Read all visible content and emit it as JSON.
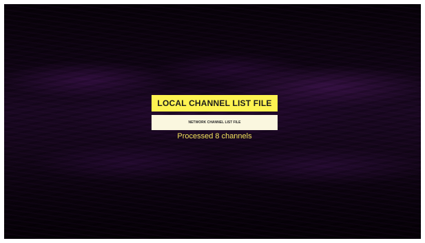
{
  "menu": {
    "local_label": "LOCAL CHANNEL LIST FILE",
    "network_label": "NETWORK CHANNEL LIST FILE"
  },
  "status": {
    "text": "Processed 8 channels"
  },
  "colors": {
    "primary_button": "#fdf251",
    "secondary_button": "#faf7df",
    "status_text": "#f3e25c",
    "background": "#14061a"
  }
}
